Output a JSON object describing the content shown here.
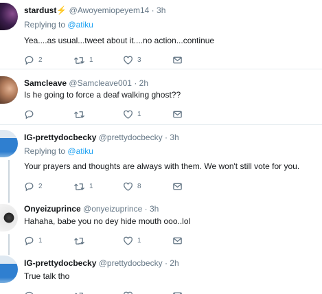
{
  "tweets": [
    {
      "name": "stardust",
      "badge": "⚡",
      "handle": "@Awoyemiopeyem14",
      "separator": "·",
      "time": "3h",
      "replying_prefix": "Replying to",
      "replying_to": "@atiku",
      "text": "Yea....as usual...tweet about it....no action...continue",
      "replies": "2",
      "retweets": "1",
      "likes": "3",
      "avatar_color": "#3a1d4a"
    },
    {
      "name": "Samcleave",
      "handle": "@Samcleave001",
      "separator": "·",
      "time": "2h",
      "text": "Is he going to force a deaf walking ghost??",
      "replies": "",
      "retweets": "",
      "likes": "1",
      "avatar_color": "#b07a5a"
    },
    {
      "name": "IG-prettydocbecky",
      "handle": "@prettydocbecky",
      "separator": "·",
      "time": "3h",
      "replying_prefix": "Replying to",
      "replying_to": "@atiku",
      "text": "Your prayers and thoughts are always with them. We won't still vote for you.",
      "replies": "2",
      "retweets": "1",
      "likes": "8",
      "avatar_color": "#2f7fd0"
    },
    {
      "name": "Onyeizuprince",
      "handle": "@onyeizuprince",
      "separator": "·",
      "time": "3h",
      "text": "Hahaha, babe you no dey hide mouth ooo..lol",
      "replies": "1",
      "retweets": "",
      "likes": "1",
      "avatar_color": "#e4e4e4"
    },
    {
      "name": "IG-prettydocbecky",
      "handle": "@prettydocbecky",
      "separator": "·",
      "time": "2h",
      "text": "True talk tho",
      "replies": "",
      "retweets": "",
      "likes": "",
      "avatar_color": "#2f7fd0"
    }
  ]
}
